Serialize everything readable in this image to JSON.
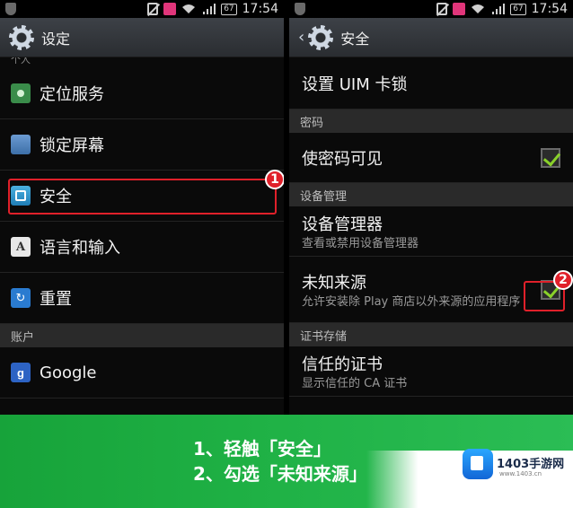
{
  "status_bar": {
    "time": "17:54",
    "battery": "67"
  },
  "left": {
    "title": "设定",
    "cut_header": "个人",
    "items": [
      {
        "label": "定位服务",
        "icon": "location-icon"
      },
      {
        "label": "锁定屏幕",
        "icon": "lock-screen-icon"
      },
      {
        "label": "安全",
        "icon": "security-icon"
      },
      {
        "label": "语言和输入",
        "icon": "language-icon",
        "glyph": "A"
      },
      {
        "label": "重置",
        "icon": "reset-icon",
        "glyph": "↻"
      }
    ],
    "section_accounts": "账户",
    "account_item": {
      "label": "Google",
      "glyph": "g"
    }
  },
  "right": {
    "title": "安全",
    "uim_lock": "设置 UIM 卡锁",
    "section_password": "密码",
    "show_password": {
      "label": "使密码可见",
      "checked": true
    },
    "section_device": "设备管理",
    "device_admin": {
      "title": "设备管理器",
      "subtitle": "查看或禁用设备管理器"
    },
    "unknown_sources": {
      "title": "未知来源",
      "subtitle": "允许安装除 Play 商店以外来源的应用程序",
      "checked": true
    },
    "section_credentials": "证书存储",
    "trusted_creds": {
      "title": "信任的证书",
      "subtitle": "显示信任的 CA 证书"
    }
  },
  "badges": {
    "step1": "1",
    "step2": "2"
  },
  "banner": {
    "line1": "1、轻触「安全」",
    "line2": "2、勾选「未知来源」",
    "logo": "1403手游网",
    "logo_sub": "www.1403.cn"
  },
  "colors": {
    "highlight": "#e0202a",
    "banner": "#1fb145",
    "check": "#8ad12a"
  }
}
